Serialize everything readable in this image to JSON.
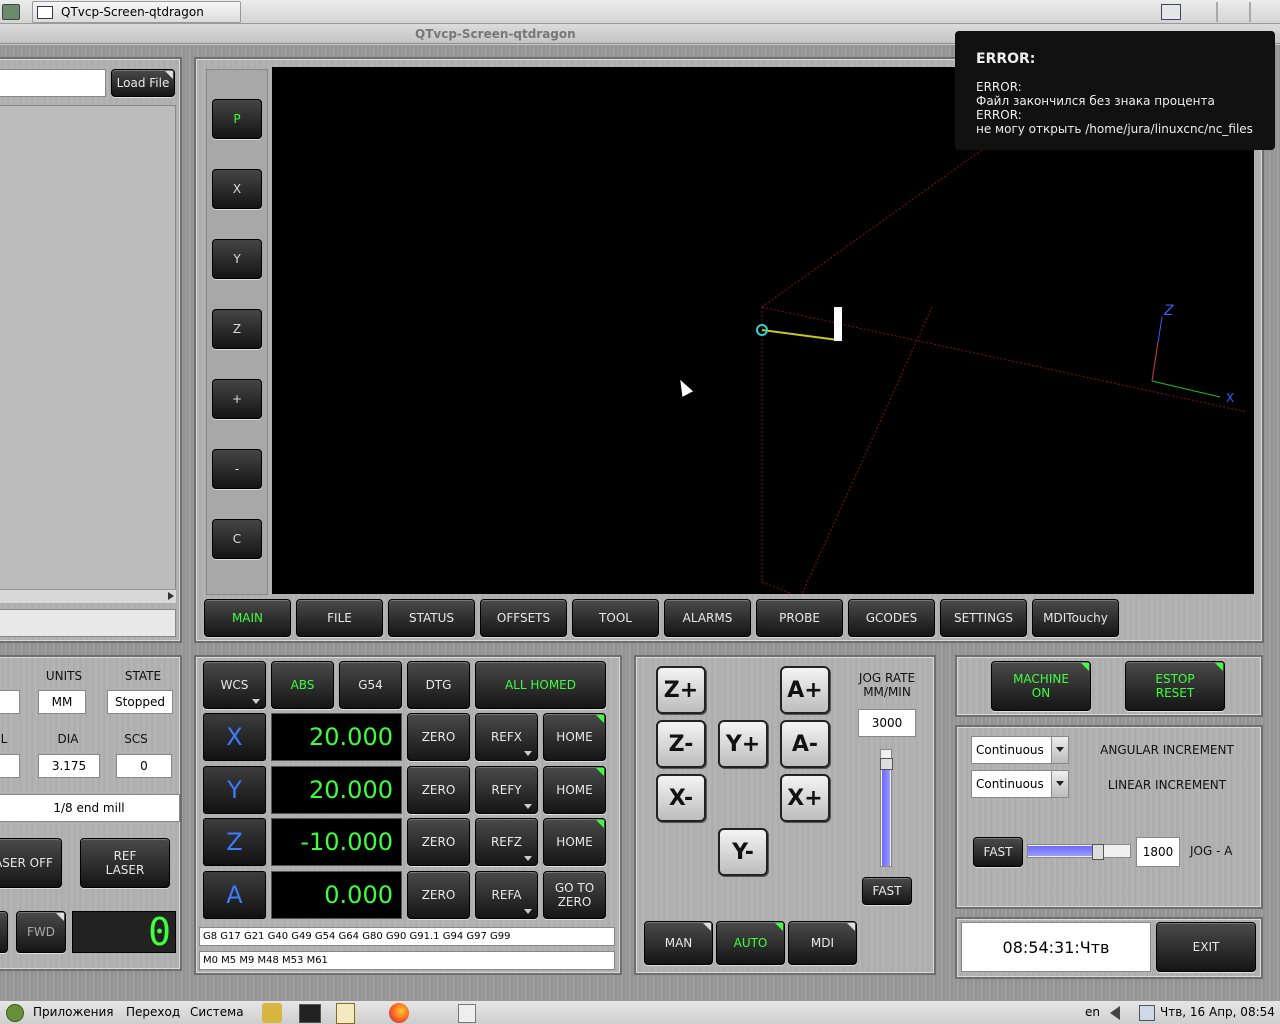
{
  "window": {
    "tab_title": "QTvcp-Screen-qtdragon",
    "title": "QTvcp-Screen-qtdragon"
  },
  "left_panel": {
    "load_file": "Load File",
    "units_label": "UNITS",
    "state_label": "STATE",
    "units_value": "MM",
    "state_value": "Stopped",
    "l_label": "L",
    "dia_label": "DIA",
    "scs_label": "SCS",
    "dia_value": "3.175",
    "scs_value": "0",
    "tool_desc": "1/8 end mill",
    "laser_off": "LASER OFF",
    "ref_laser": "REF LASER",
    "fwd": "FWD",
    "spindle_digit": "0"
  },
  "view_buttons": [
    "P",
    "X",
    "Y",
    "Z",
    "+",
    "-",
    "C"
  ],
  "graphics": {
    "axis_z": "Z",
    "axis_x": "X"
  },
  "error": {
    "heading": "ERROR:",
    "line1": "ERROR:",
    "line2": "Файл закончился без знака процента",
    "line3": "ERROR:",
    "line4": "не могу открыть /home/jura/linuxcnc/nc_files"
  },
  "tabs": [
    "MAIN",
    "FILE",
    "STATUS",
    "OFFSETS",
    "TOOL",
    "ALARMS",
    "PROBE",
    "GCODES",
    "SETTINGS",
    "MDITouchy"
  ],
  "dro_header": {
    "wcs": "WCS",
    "abs": "ABS",
    "g54": "G54",
    "dtg": "DTG",
    "all_homed": "ALL HOMED"
  },
  "dro": [
    {
      "axis": "X",
      "value": "20.000",
      "zero": "ZERO",
      "ref": "REFX",
      "home": "HOME"
    },
    {
      "axis": "Y",
      "value": "20.000",
      "zero": "ZERO",
      "ref": "REFY",
      "home": "HOME"
    },
    {
      "axis": "Z",
      "value": "-10.000",
      "zero": "ZERO",
      "ref": "REFZ",
      "home": "HOME"
    },
    {
      "axis": "A",
      "value": "0.000",
      "zero": "ZERO",
      "ref": "REFA",
      "home": "GO TO ZERO"
    }
  ],
  "gcodes_active": "G8 G17 G21 G40 G49 G54 G64 G80 G90 G91.1 G94 G97 G99",
  "mcodes_active": "M0 M5 M9 M48 M53 M61",
  "jog": {
    "zplus": "Z+",
    "zminus": "Z-",
    "aplus": "A+",
    "aminus": "A-",
    "yplus": "Y+",
    "yminus": "Y-",
    "xminus": "X-",
    "xplus": "X+",
    "rate_label1": "JOG RATE",
    "rate_label2": "MM/MIN",
    "rate_value": "3000",
    "fast": "FAST",
    "rate_level": 0.92
  },
  "modes": {
    "man": "MAN",
    "auto": "AUTO",
    "mdi": "MDI"
  },
  "machine": {
    "machine_on": "MACHINE ON",
    "estop_reset": "ESTOP RESET"
  },
  "increments": {
    "angular_value": "Continuous",
    "angular_label": "ANGULAR INCREMENT",
    "linear_value": "Continuous",
    "linear_label": "LINEAR INCREMENT",
    "fast": "FAST",
    "jog_a_value": "1800",
    "jog_a_label": "JOG - A",
    "jog_a_level": 0.7
  },
  "clock": "08:54:31:Чтв",
  "exit": "EXIT",
  "taskbar": {
    "apps": "Приложения",
    "places": "Переход",
    "system": "Система",
    "lang": "en",
    "datetime": "Чтв, 16 Апр, 08:54"
  },
  "colors": {
    "accent_green": "#3dff3d",
    "axis_blue": "#3a7bff"
  }
}
